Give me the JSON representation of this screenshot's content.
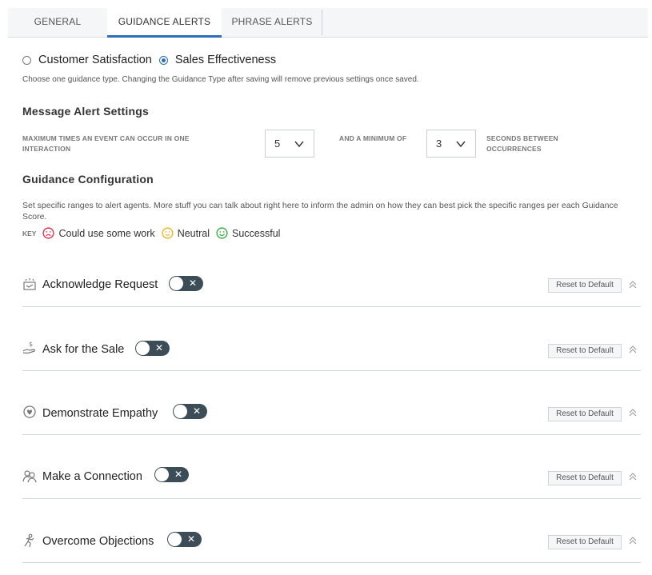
{
  "tabs": [
    {
      "label": "GENERAL"
    },
    {
      "label": "GUIDANCE ALERTS",
      "active": true
    },
    {
      "label": "PHRASE ALERTS"
    }
  ],
  "guidance_type": {
    "options": [
      {
        "label": "Customer Satisfaction",
        "checked": false
      },
      {
        "label": "Sales Effectiveness",
        "checked": true
      }
    ],
    "help": "Choose one guidance type. Changing the Guidance Type after saving will remove previous settings once saved."
  },
  "message_alert": {
    "title": "Message Alert Settings",
    "max_label": "MAXIMUM TIMES AN EVENT CAN OCCUR IN ONE INTERACTION",
    "max_value": "5",
    "min_label": "AND A MINIMUM OF",
    "min_value": "3",
    "seconds_label": "SECONDS BETWEEN OCCURRENCES"
  },
  "guidance_config": {
    "title": "Guidance Configuration",
    "description": "Set specific ranges to alert agents. More stuff you can talk about right here to inform the admin on how they can best pick the specific ranges per each Guidance Score.",
    "key_label": "KEY",
    "key_items": [
      {
        "label": "Could use some work",
        "icon": "sad-face-icon",
        "color": "#e0334f"
      },
      {
        "label": "Neutral",
        "icon": "neutral-face-icon",
        "color": "#f0b429"
      },
      {
        "label": "Successful",
        "icon": "happy-face-icon",
        "color": "#3fae49"
      }
    ]
  },
  "guidance_items": [
    {
      "name": "Acknowledge Request",
      "icon": "acknowledge-icon",
      "enabled": false,
      "toggle_mark": "✕"
    },
    {
      "name": "Ask for the Sale",
      "icon": "money-hand-icon",
      "enabled": false,
      "toggle_mark": "✕"
    },
    {
      "name": "Demonstrate Empathy",
      "icon": "empathy-icon",
      "enabled": false,
      "toggle_mark": "✕"
    },
    {
      "name": "Make a Connection",
      "icon": "people-icon",
      "enabled": false,
      "toggle_mark": "✕"
    },
    {
      "name": "Overcome Objections",
      "icon": "running-figure-icon",
      "enabled": false,
      "toggle_mark": "✕"
    }
  ],
  "reset_label": "Reset to Default",
  "colors": {
    "accent": "#2a6fb8",
    "toggle_off": "#3d4d57"
  }
}
